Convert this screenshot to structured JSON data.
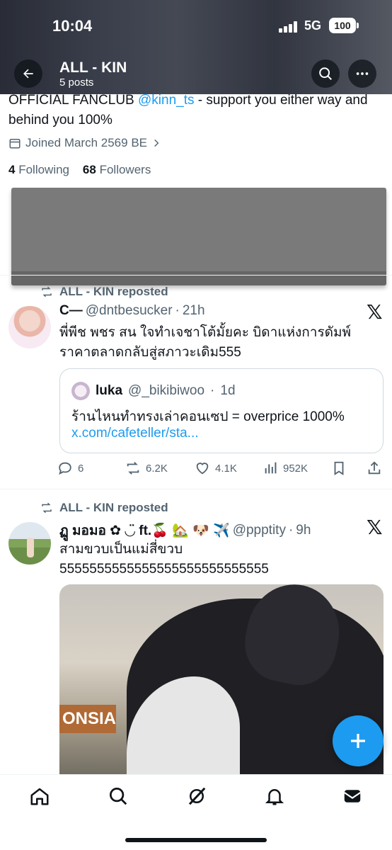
{
  "status_bar": {
    "time": "10:04",
    "network": "5G",
    "battery": "100"
  },
  "header": {
    "account_name": "ALL - KIN",
    "post_count": "5 posts"
  },
  "profile": {
    "bio_prefix": "OFFICIAL FANCLUB ",
    "bio_mention": "@kinn_ts",
    "bio_suffix": " - support you either way and behind you 100%",
    "joined": "Joined March 2569 BE",
    "following_count": "4",
    "following_label": "Following",
    "followers_count": "68",
    "followers_label": "Followers"
  },
  "feed": [
    {
      "repost_label": "ALL - KIN reposted",
      "name": "C—",
      "handle": "@dntbesucker",
      "time": "21h",
      "text_line1": "พี่พีช พชร สน ใจทำเจชาโต้มั้ยคะ บิดาแห่งการดัมพ์",
      "text_line2": "ราคาตลาดกลับสู่สภาวะเดิม555",
      "quote": {
        "name": "luka",
        "handle": "@_bikibiwoo",
        "time": "1d",
        "text": "ร้านไหนทำทรงเล่าคอนเซป = overprice 1000%",
        "link": "x.com/cafeteller/sta..."
      },
      "stats": {
        "replies": "6",
        "reposts": "6.2K",
        "likes": "4.1K",
        "views": "952K"
      }
    },
    {
      "repost_label": "ALL - KIN reposted",
      "name": "ฏู มอมอ ✿ ◡̈ ft.🍒 🏡 🐶 ✈️",
      "handle": "@ppptity",
      "time": "9h",
      "text_line1": "สามขวบเป็นแม่สี่ขวบ",
      "text_line2": "5555555555555555555555555555",
      "media_sign": "ONSIAM"
    }
  ],
  "separator": "·",
  "x_logo": "𝕏",
  "icons": {
    "back": "back-arrow-icon",
    "search": "search-icon",
    "more": "more-icon",
    "calendar": "calendar-icon",
    "repost": "repost-icon",
    "reply": "reply-icon",
    "like": "heart-icon",
    "views": "views-icon",
    "bookmark": "bookmark-icon",
    "share": "share-icon",
    "compose": "plus-icon",
    "home": "home-icon",
    "explore": "search-icon",
    "grok": "grok-icon",
    "notifications": "bell-icon",
    "messages": "mail-icon"
  },
  "colors": {
    "accent": "#1d9bf0",
    "text_secondary": "#536471"
  }
}
